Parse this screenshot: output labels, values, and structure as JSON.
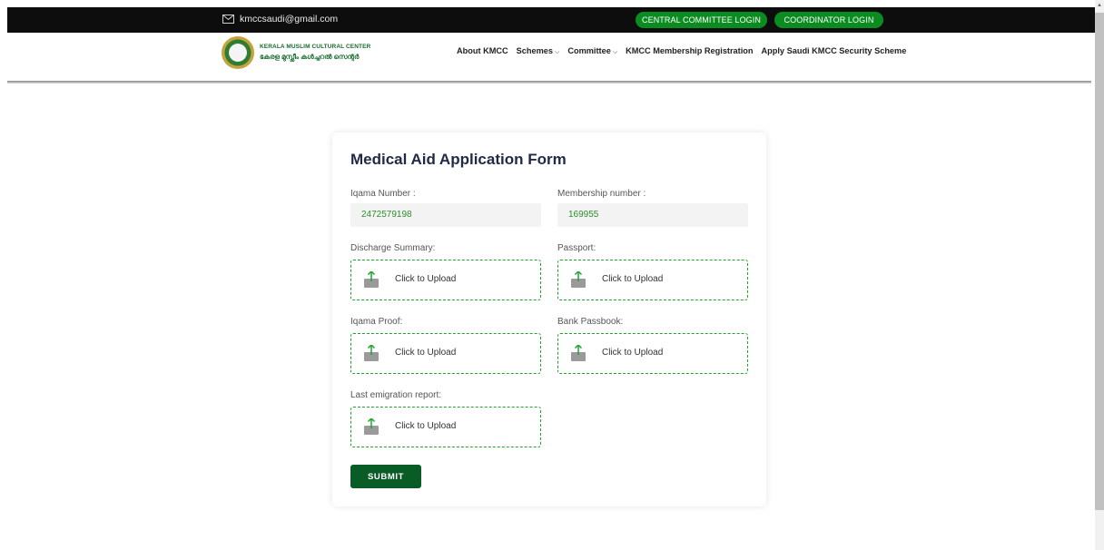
{
  "topbar": {
    "email": "kmccsaudi@gmail.com",
    "central_login": "CENTRAL COMMITTEE LOGIN",
    "coordinator_login": "COORDINATOR LOGIN",
    "accent_color": "#0b8c21"
  },
  "header": {
    "logo_line1": "KERALA MUSLIM CULTURAL CENTER",
    "logo_line2": "കേരള മുസ്ലീം കൾച്ചറൽ സെന്റർ",
    "nav": {
      "about": "About KMCC",
      "schemes": "Schemes",
      "committee": "Committee",
      "membership": "KMCC Membership Registration",
      "security": "Apply Saudi KMCC Security Scheme"
    }
  },
  "form": {
    "title": "Medical Aid Application Form",
    "iqama_label": "Iqama Number :",
    "iqama_value": "2472579198",
    "membership_label": "Membership number :",
    "membership_value": "169955",
    "discharge_label": "Discharge Summary:",
    "passport_label": "Passport:",
    "iqama_proof_label": "Iqama Proof:",
    "bank_label": "Bank Passbook:",
    "emigration_label": "Last emigration report:",
    "upload_text": "Click to Upload",
    "submit_label": "SUBMIT",
    "submit_color": "#0a5c27",
    "upload_border_color": "#1ea52b"
  }
}
